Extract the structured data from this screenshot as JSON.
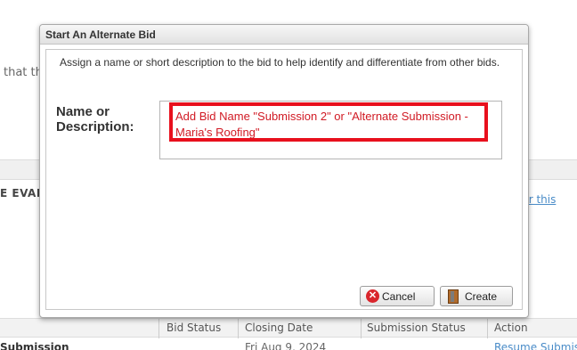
{
  "background": {
    "intro_text": "that th",
    "section_label": "E EVAL",
    "side_link": "er for this",
    "table_headers": [
      "Bid Status",
      "Closing Date",
      "Submission Status",
      "Action"
    ],
    "row": {
      "name": "Submission",
      "closing_date": "Fri Aug 9, 2024",
      "action": "Resume Submis"
    }
  },
  "modal": {
    "title": "Start An Alternate Bid",
    "description": "Assign a name or short description to the bid to help identify and differentiate from other bids.",
    "name_label": "Name or Description:",
    "name_value": "",
    "annotation": "Add Bid Name \"Submission 2\" or \"Alternate Submission - Maria's Roofing\"",
    "cancel_label": "Cancel",
    "create_label": "Create",
    "annotation_color": "#e8101d"
  }
}
